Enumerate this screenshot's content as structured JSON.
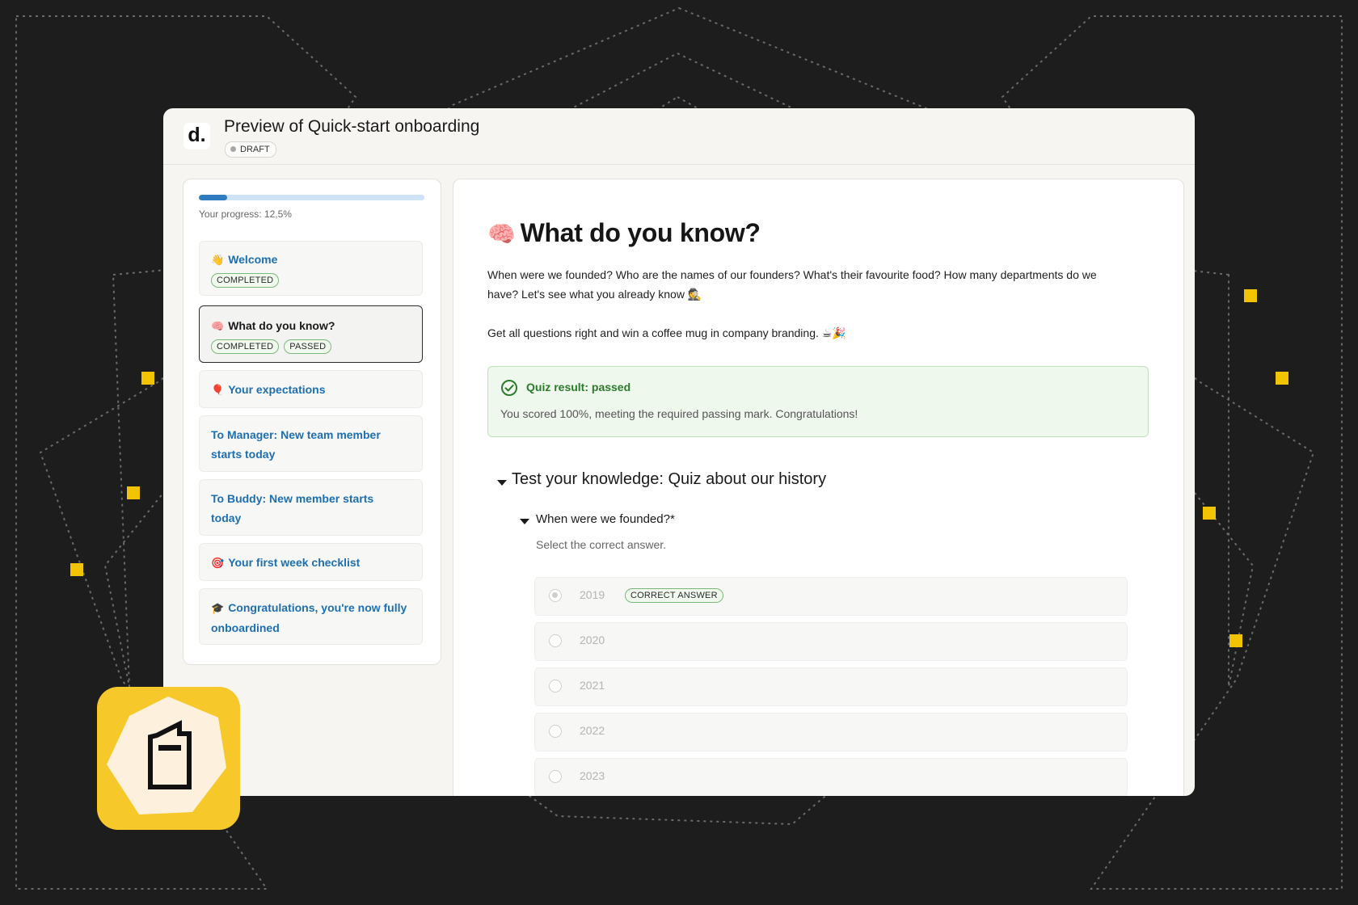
{
  "colors": {
    "background": "#1d1d1d",
    "accent": "#2e7bbf",
    "link": "#1d6fb0",
    "success": "#2c7a2c",
    "highlight_square": "#f2c300",
    "app_icon": "#f7c82a"
  },
  "header": {
    "logo_text": "d.",
    "title": "Preview of Quick-start onboarding",
    "badge": "DRAFT"
  },
  "sidebar": {
    "progress_fraction": 0.125,
    "progress_label": "Your progress: 12,5%",
    "items": [
      {
        "emoji": "👋",
        "label": "Welcome",
        "statuses": [
          "COMPLETED"
        ]
      },
      {
        "emoji": "🧠",
        "label": "What do you know?",
        "statuses": [
          "COMPLETED",
          "PASSED"
        ]
      },
      {
        "emoji": "🎈",
        "label": "Your expectations",
        "statuses": []
      },
      {
        "emoji": "",
        "label_line1": "To Manager: New team member",
        "label_line2": "starts today",
        "statuses": []
      },
      {
        "emoji": "",
        "label_line1": "To Buddy: New member starts",
        "label_line2": "today",
        "statuses": []
      },
      {
        "emoji": "🎯",
        "label": "Your first week checklist",
        "statuses": []
      },
      {
        "emoji": "🎓",
        "label_line1": "Congratulations, you're now fully",
        "label_line2": "onboardined",
        "statuses": []
      }
    ]
  },
  "main": {
    "title_emoji": "🧠",
    "title": "What do you know?",
    "intro_line1": "When were we founded? Who are the names of our founders? What's their favourite food? How many departments do we",
    "intro_line2": "have? Let's see what you already know 🕵",
    "intro2": "Get all questions right and win a coffee mug in company branding. ☕🎉",
    "result": {
      "icon": "check-circle-icon",
      "title": "Quiz result: passed",
      "text": "You scored 100%, meeting the required passing mark. Congratulations!"
    },
    "section_title": "Test your knowledge: Quiz about our history",
    "question": {
      "title": "When were we founded?*",
      "hint": "Select the correct answer.",
      "answers": [
        {
          "label": "2019",
          "selected": true,
          "tag": "CORRECT ANSWER"
        },
        {
          "label": "2020",
          "selected": false
        },
        {
          "label": "2021",
          "selected": false
        },
        {
          "label": "2022",
          "selected": false
        },
        {
          "label": "2023",
          "selected": false
        }
      ]
    }
  },
  "app_icon": {
    "icon": "book-icon"
  }
}
